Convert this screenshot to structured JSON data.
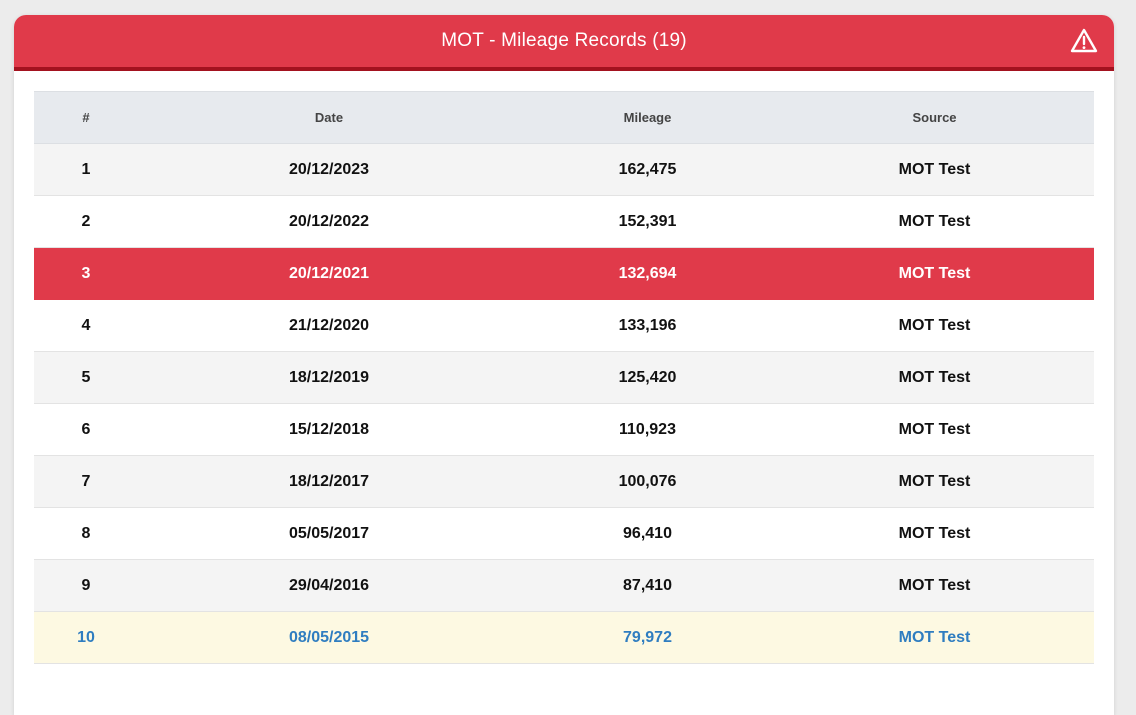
{
  "header": {
    "title": "MOT - Mileage Records (19)",
    "icon": "warning-icon",
    "color": "#e03a4a",
    "border_color": "#a3121f"
  },
  "table": {
    "columns": [
      "#",
      "Date",
      "Mileage",
      "Source"
    ],
    "rows": [
      {
        "num": "1",
        "date": "20/12/2023",
        "mileage": "162,475",
        "source": "MOT Test",
        "style": "odd"
      },
      {
        "num": "2",
        "date": "20/12/2022",
        "mileage": "152,391",
        "source": "MOT Test",
        "style": "even"
      },
      {
        "num": "3",
        "date": "20/12/2021",
        "mileage": "132,694",
        "source": "MOT Test",
        "style": "alert"
      },
      {
        "num": "4",
        "date": "21/12/2020",
        "mileage": "133,196",
        "source": "MOT Test",
        "style": "even"
      },
      {
        "num": "5",
        "date": "18/12/2019",
        "mileage": "125,420",
        "source": "MOT Test",
        "style": "odd"
      },
      {
        "num": "6",
        "date": "15/12/2018",
        "mileage": "110,923",
        "source": "MOT Test",
        "style": "even"
      },
      {
        "num": "7",
        "date": "18/12/2017",
        "mileage": "100,076",
        "source": "MOT Test",
        "style": "odd"
      },
      {
        "num": "8",
        "date": "05/05/2017",
        "mileage": "96,410",
        "source": "MOT Test",
        "style": "even"
      },
      {
        "num": "9",
        "date": "29/04/2016",
        "mileage": "87,410",
        "source": "MOT Test",
        "style": "odd"
      },
      {
        "num": "10",
        "date": "08/05/2015",
        "mileage": "79,972",
        "source": "MOT Test",
        "style": "highlight"
      }
    ]
  },
  "colors": {
    "alert_row": "#e03a4a",
    "highlight_row": "#fdf9e2",
    "highlight_text": "#2f7dc0"
  }
}
